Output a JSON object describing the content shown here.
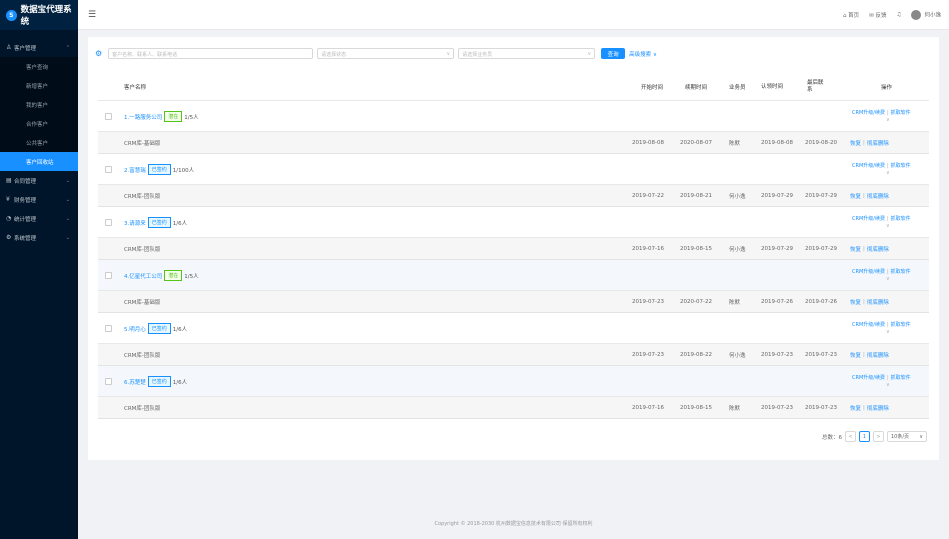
{
  "app": {
    "title": "数据宝代理系统",
    "logo_glyph": "S"
  },
  "sidebar": {
    "groups": [
      {
        "icon": "user-icon",
        "glyph": "♙",
        "label": "客户管理",
        "expanded": true,
        "items": [
          "客户查询",
          "新增客户",
          "我的客户",
          "合作客户",
          "公共客户",
          "客户回收站"
        ],
        "active_index": 5
      },
      {
        "icon": "contract-icon",
        "glyph": "▤",
        "label": "合同管理"
      },
      {
        "icon": "finance-icon",
        "glyph": "¥",
        "label": "财务管理"
      },
      {
        "icon": "stats-icon",
        "glyph": "◔",
        "label": "统计管理"
      },
      {
        "icon": "settings-icon",
        "glyph": "⚙",
        "label": "系统管理"
      }
    ]
  },
  "topbar": {
    "collapse_glyph": "☰",
    "home": "⌂ 首页",
    "feedback": "✉ 反馈",
    "bell": "♫",
    "user": "何小逸"
  },
  "filters": {
    "keyword_placeholder": "客户名称、联系人、联系电话",
    "status_placeholder": "请选择状态",
    "staff_placeholder": "请选择业务员",
    "query_label": "查询",
    "advanced_label": "高级搜索 ∨"
  },
  "table": {
    "headers": {
      "name": "客户名称",
      "start": "开始时间",
      "expire": "续期时间",
      "staff": "业务员",
      "certify": "认领时间",
      "contact": "最后联系",
      "ops": "操作"
    },
    "rows": [
      {
        "name": "1.一路服务公司",
        "tag": "潜在",
        "tag_color": "green",
        "count": "1/5人",
        "lib": "CRM库-基础版",
        "start": "2019-08-08",
        "expire": "2020-08-07",
        "staff": "陈默",
        "certify": "2019-08-08",
        "contact": "2019-08-20"
      },
      {
        "name": "2.富慧瑞",
        "tag": "已签约",
        "tag_color": "blue",
        "count": "1/100人",
        "lib": "CRM库-团队版",
        "start": "2019-07-22",
        "expire": "2019-08-21",
        "staff": "何小逸",
        "certify": "2019-07-29",
        "contact": "2019-07-29"
      },
      {
        "name": "3.请源来",
        "tag": "已签约",
        "tag_color": "blue",
        "count": "1/6人",
        "lib": "CRM库-团队版",
        "start": "2019-07-16",
        "expire": "2019-08-15",
        "staff": "何小逸",
        "certify": "2019-07-29",
        "contact": "2019-07-29"
      },
      {
        "name": "4.亿星代工公司",
        "tag": "潜在",
        "tag_color": "green",
        "count": "1/5人",
        "lib": "CRM库-基础版",
        "start": "2019-07-23",
        "expire": "2020-07-22",
        "staff": "陈默",
        "certify": "2019-07-26",
        "contact": "2019-07-26"
      },
      {
        "name": "5.明月心",
        "tag": "已签约",
        "tag_color": "blue",
        "count": "1/6人",
        "lib": "CRM库-团队版",
        "start": "2019-07-23",
        "expire": "2019-08-22",
        "staff": "何小逸",
        "certify": "2019-07-23",
        "contact": "2019-07-23"
      },
      {
        "name": "6.苏楚楚",
        "tag": "已签约",
        "tag_color": "blue",
        "count": "1/6人",
        "lib": "CRM库-团队版",
        "start": "2019-07-16",
        "expire": "2019-08-15",
        "staff": "陈默",
        "certify": "2019-07-23",
        "contact": "2019-07-23"
      }
    ],
    "op_upgrade": "CRM升级/续费",
    "op_capture": "抓取软件",
    "op_restore": "恢复",
    "op_delete": "彻底删除"
  },
  "pager": {
    "total": "总数：6",
    "prev": "<",
    "current": "1",
    "next": ">",
    "size": "10条/页"
  },
  "footer": "Copyright © 2018-2030 杭州数据宝信息技术有限公司 保留所有权利"
}
